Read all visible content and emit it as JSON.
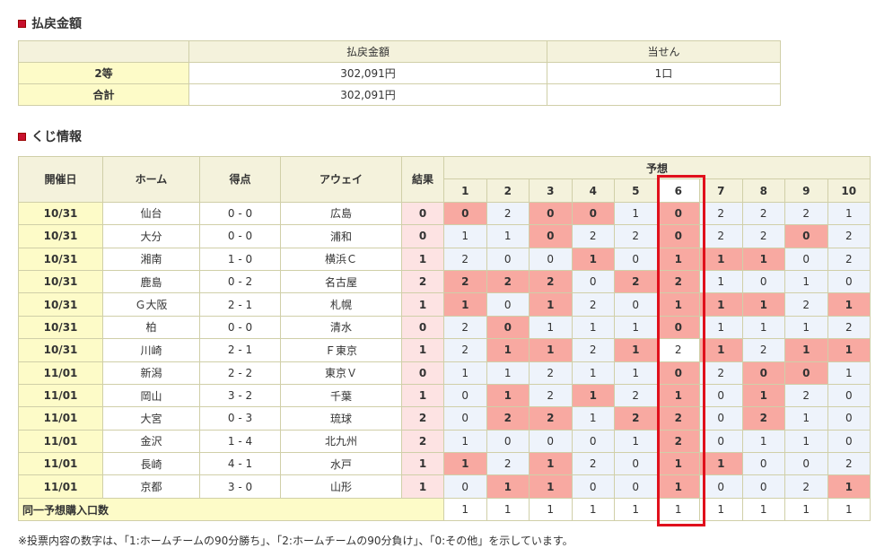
{
  "payout": {
    "title": "払戻金額",
    "headers": [
      "",
      "払戻金額",
      "当せん"
    ],
    "rows": [
      {
        "label": "2等",
        "amount": "302,091円",
        "winners": "1口"
      },
      {
        "label": "合計",
        "amount": "302,091円",
        "winners": ""
      }
    ]
  },
  "kuji": {
    "title": "くじ情報",
    "headers": {
      "date": "開催日",
      "home": "ホーム",
      "score": "得点",
      "away": "アウェイ",
      "result": "結果",
      "prediction": "予想"
    },
    "pred_cols": [
      "1",
      "2",
      "3",
      "4",
      "5",
      "6",
      "7",
      "8",
      "9",
      "10"
    ],
    "highlighted_col": "6",
    "matches": [
      {
        "date": "10/31",
        "home": "仙台",
        "score": "0 - 0",
        "away": "広島",
        "result": "0",
        "preds": [
          "0",
          "2",
          "0",
          "0",
          "1",
          "0",
          "2",
          "2",
          "2",
          "1"
        ]
      },
      {
        "date": "10/31",
        "home": "大分",
        "score": "0 - 0",
        "away": "浦和",
        "result": "0",
        "preds": [
          "1",
          "1",
          "0",
          "2",
          "2",
          "0",
          "2",
          "2",
          "0",
          "2"
        ]
      },
      {
        "date": "10/31",
        "home": "湘南",
        "score": "1 - 0",
        "away": "横浜Ｃ",
        "result": "1",
        "preds": [
          "2",
          "0",
          "0",
          "1",
          "0",
          "1",
          "1",
          "1",
          "0",
          "2"
        ]
      },
      {
        "date": "10/31",
        "home": "鹿島",
        "score": "0 - 2",
        "away": "名古屋",
        "result": "2",
        "preds": [
          "2",
          "2",
          "2",
          "0",
          "2",
          "2",
          "1",
          "0",
          "1",
          "0"
        ]
      },
      {
        "date": "10/31",
        "home": "Ｇ大阪",
        "score": "2 - 1",
        "away": "札幌",
        "result": "1",
        "preds": [
          "1",
          "0",
          "1",
          "2",
          "0",
          "1",
          "1",
          "1",
          "2",
          "1"
        ]
      },
      {
        "date": "10/31",
        "home": "柏",
        "score": "0 - 0",
        "away": "清水",
        "result": "0",
        "preds": [
          "2",
          "0",
          "1",
          "1",
          "1",
          "0",
          "1",
          "1",
          "1",
          "2"
        ]
      },
      {
        "date": "10/31",
        "home": "川崎",
        "score": "2 - 1",
        "away": "Ｆ東京",
        "result": "1",
        "preds": [
          "2",
          "1",
          "1",
          "2",
          "1",
          "2",
          "1",
          "2",
          "1",
          "1"
        ]
      },
      {
        "date": "11/01",
        "home": "新潟",
        "score": "2 - 2",
        "away": "東京Ｖ",
        "result": "0",
        "preds": [
          "1",
          "1",
          "2",
          "1",
          "1",
          "0",
          "2",
          "0",
          "0",
          "1"
        ]
      },
      {
        "date": "11/01",
        "home": "岡山",
        "score": "3 - 2",
        "away": "千葉",
        "result": "1",
        "preds": [
          "0",
          "1",
          "2",
          "1",
          "2",
          "1",
          "0",
          "1",
          "2",
          "0"
        ]
      },
      {
        "date": "11/01",
        "home": "大宮",
        "score": "0 - 3",
        "away": "琉球",
        "result": "2",
        "preds": [
          "0",
          "2",
          "2",
          "1",
          "2",
          "2",
          "0",
          "2",
          "1",
          "0"
        ]
      },
      {
        "date": "11/01",
        "home": "金沢",
        "score": "1 - 4",
        "away": "北九州",
        "result": "2",
        "preds": [
          "1",
          "0",
          "0",
          "0",
          "1",
          "2",
          "0",
          "1",
          "1",
          "0"
        ]
      },
      {
        "date": "11/01",
        "home": "長崎",
        "score": "4 - 1",
        "away": "水戸",
        "result": "1",
        "preds": [
          "1",
          "2",
          "1",
          "2",
          "0",
          "1",
          "1",
          "0",
          "0",
          "2"
        ]
      },
      {
        "date": "11/01",
        "home": "京都",
        "score": "3 - 0",
        "away": "山形",
        "result": "1",
        "preds": [
          "0",
          "1",
          "1",
          "0",
          "0",
          "1",
          "0",
          "0",
          "2",
          "1"
        ]
      }
    ],
    "footer_label": "同一予想購入口数",
    "footer_values": [
      "1",
      "1",
      "1",
      "1",
      "1",
      "1",
      "1",
      "1",
      "1",
      "1"
    ]
  },
  "note": "※投票内容の数字は、「1:ホームチームの90分勝ち」、「2:ホームチームの90分負け」、「0:その他」を示しています。",
  "colors": {
    "accent": "#c8102e",
    "match": "#f8a9a1",
    "miss": "#eef3fb",
    "header": "#f4f2dc",
    "label": "#fdfbc8",
    "highlight_border": "#e0101c"
  }
}
